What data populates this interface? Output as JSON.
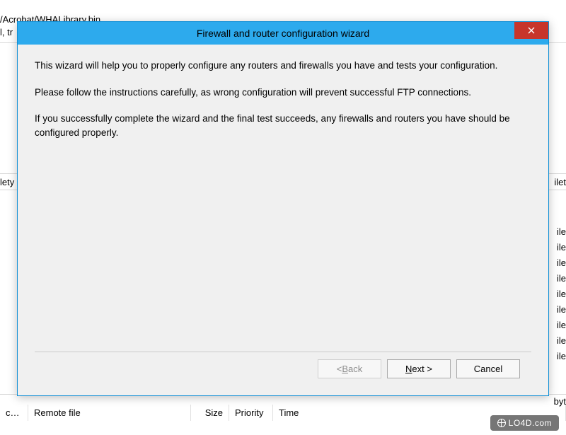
{
  "background": {
    "line1": "/Acrobat/WHALibrary.bin",
    "line2": "l, tr",
    "left_col_header_fragment": "lety",
    "right_col_header_fragment": "ilet",
    "right_list": [
      "ile",
      "ile",
      "ile",
      "ile",
      "ile",
      "ile",
      "ile",
      "ile",
      "ile"
    ],
    "bottom": {
      "col1": "c…",
      "col2": "Remote file",
      "col3": "Size",
      "col4": "Priority",
      "col5": "Time",
      "right_fragment": "byt"
    }
  },
  "dialog": {
    "title": "Firewall and router configuration wizard",
    "para1": "This wizard will help you to properly configure any routers and firewalls you have and tests your configuration.",
    "para2": "Please follow the instructions carefully, as wrong configuration will prevent successful FTP connections.",
    "para3": "If you successfully complete the wizard and the final test succeeds, any firewalls and routers you have should be configured properly.",
    "buttons": {
      "back_prefix": "< ",
      "back_mnemonic": "B",
      "back_suffix": "ack",
      "next_mnemonic": "N",
      "next_suffix": "ext >",
      "cancel": "Cancel"
    }
  },
  "watermark": "LO4D.com"
}
